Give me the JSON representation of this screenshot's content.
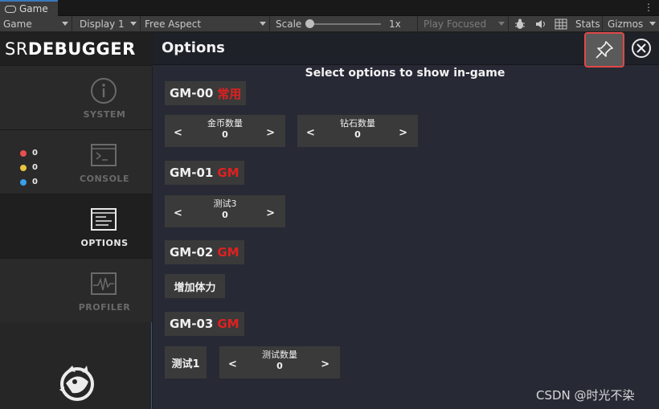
{
  "window_tab": {
    "label": "Game"
  },
  "toolbar": {
    "view": "Game",
    "display": "Display 1",
    "aspect": "Free Aspect",
    "scale_label": "Scale",
    "scale_value": "1x",
    "play_mode": "Play Focused",
    "stats": "Stats",
    "gizmos": "Gizmos"
  },
  "sidebar": {
    "brand_prefix": "SR",
    "brand_rest": "DEBUGGER",
    "items": [
      {
        "label": "SYSTEM"
      },
      {
        "label": "CONSOLE"
      },
      {
        "label": "OPTIONS"
      },
      {
        "label": "PROFILER"
      }
    ],
    "console_counts": [
      {
        "value": "0",
        "color": "#e85050"
      },
      {
        "value": "0",
        "color": "#e8c440"
      },
      {
        "value": "0",
        "color": "#3aa0e8"
      }
    ]
  },
  "main": {
    "title": "Options",
    "subtitle": "Select options to show in-game",
    "categories": [
      {
        "name": "GM-00",
        "tag": "常用"
      },
      {
        "name": "GM-01",
        "tag": "GM"
      },
      {
        "name": "GM-02",
        "tag": "GM"
      },
      {
        "name": "GM-03",
        "tag": "GM"
      }
    ],
    "numbers": [
      {
        "label": "金币数量",
        "value": "0",
        "left": "<",
        "right": ">"
      },
      {
        "label": "钻石数量",
        "value": "0",
        "left": "<",
        "right": ">"
      },
      {
        "label": "测试3",
        "value": "0",
        "left": "<",
        "right": ">"
      },
      {
        "label": "测试数量",
        "value": "0",
        "left": "<",
        "right": ">"
      }
    ],
    "buttons": [
      {
        "label": "增加体力"
      },
      {
        "label": "测试1"
      }
    ]
  },
  "watermark": "CSDN @时光不染"
}
